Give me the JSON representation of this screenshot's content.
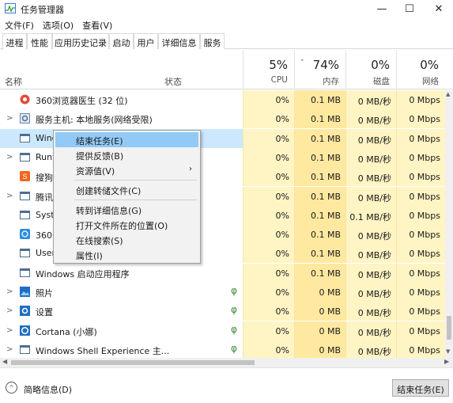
{
  "window": {
    "title": "任务管理器",
    "controls": {
      "min": "—",
      "max": "☐",
      "close": "✕"
    }
  },
  "menubar": [
    "文件(F)",
    "选项(O)",
    "查看(V)"
  ],
  "tabs": [
    "进程",
    "性能",
    "应用历史记录",
    "启动",
    "用户",
    "详细信息",
    "服务"
  ],
  "columns": {
    "name": "名称",
    "status": "状态",
    "sort_arrow": "˅",
    "cpu": {
      "pct": "5%",
      "label": "CPU"
    },
    "memory": {
      "pct": "74%",
      "label": "内存"
    },
    "disk": {
      "pct": "0%",
      "label": "磁盘"
    },
    "network": {
      "pct": "0%",
      "label": "网络"
    }
  },
  "rows": [
    {
      "expand": "",
      "name": "360浏览器医生 (32 位)",
      "leaf": "",
      "cpu": "0%",
      "mem": "0.1 MB",
      "disk": "0 MB/秒",
      "net": "0 Mbps",
      "icon": "red-circle-icon"
    },
    {
      "expand": ">",
      "name": "服务主机: 本地服务(网络受限)",
      "leaf": "",
      "cpu": "0%",
      "mem": "0.1 MB",
      "disk": "0 MB/秒",
      "net": "0 Mbps",
      "icon": "gear-icon"
    },
    {
      "expand": "",
      "name": "Wind",
      "leaf": "",
      "cpu": "0%",
      "mem": "0.1 MB",
      "disk": "0 MB/秒",
      "net": "0 Mbps",
      "icon": "window-icon"
    },
    {
      "expand": ">",
      "name": "Runt",
      "leaf": "",
      "cpu": "0%",
      "mem": "0.1 MB",
      "disk": "0 MB/秒",
      "net": "0 Mbps",
      "icon": "window-icon"
    },
    {
      "expand": "",
      "name": "搜狗",
      "leaf": "",
      "cpu": "0%",
      "mem": "0.1 MB",
      "disk": "0 MB/秒",
      "net": "0 Mbps",
      "icon": "sogou-icon"
    },
    {
      "expand": ">",
      "name": "腾讯",
      "leaf": "",
      "cpu": "0%",
      "mem": "0.1 MB",
      "disk": "0 MB/秒",
      "net": "0 Mbps",
      "icon": "window-icon"
    },
    {
      "expand": "",
      "name": "Syst",
      "leaf": "",
      "cpu": "0%",
      "mem": "0.1 MB",
      "disk": "0.1 MB/秒",
      "net": "0 Mbps",
      "icon": "window-icon"
    },
    {
      "expand": "",
      "name": "360安",
      "leaf": "",
      "cpu": "0%",
      "mem": "0.1 MB",
      "disk": "0 MB/秒",
      "net": "0 Mbps",
      "icon": "360-icon"
    },
    {
      "expand": "",
      "name": "User",
      "leaf": "",
      "cpu": "0%",
      "mem": "0.1 MB",
      "disk": "0 MB/秒",
      "net": "0 Mbps",
      "icon": "window-icon"
    },
    {
      "expand": "",
      "name": "Windows 启动应用程序",
      "leaf": "",
      "cpu": "0%",
      "mem": "0.1 MB",
      "disk": "0 MB/秒",
      "net": "0 Mbps",
      "icon": "window-icon"
    },
    {
      "expand": ">",
      "name": "照片",
      "leaf": "φ",
      "cpu": "0%",
      "mem": "0 MB",
      "disk": "0 MB/秒",
      "net": "0 Mbps",
      "icon": "photo-icon"
    },
    {
      "expand": ">",
      "name": "设置",
      "leaf": "φ",
      "cpu": "0%",
      "mem": "0 MB",
      "disk": "0 MB/秒",
      "net": "0 Mbps",
      "icon": "settings-icon"
    },
    {
      "expand": ">",
      "name": "Cortana (小娜)",
      "leaf": "φ",
      "cpu": "0%",
      "mem": "0 MB",
      "disk": "0 MB/秒",
      "net": "0 Mbps",
      "icon": "cortana-icon"
    },
    {
      "expand": ">",
      "name": "Windows Shell Experience 主...",
      "leaf": "φ",
      "cpu": "0%",
      "mem": "0 MB",
      "disk": "0 MB/秒",
      "net": "0 Mbps",
      "icon": "window-icon"
    }
  ],
  "context_menu": {
    "items": [
      "结束任务(E)",
      "提供反馈(B)",
      "资源值(V)",
      "创建转储文件(C)",
      "转到详细信息(G)",
      "打开文件所在的位置(O)",
      "在线搜索(S)",
      "属性(I)"
    ],
    "submenu_arrow": "›"
  },
  "footer": {
    "icon": "^",
    "less_details": "简略信息(D)",
    "end_task": "结束任务(E)"
  },
  "scroll": {
    "up": "▲",
    "down": "▼",
    "left": "◀",
    "right": "▶"
  }
}
